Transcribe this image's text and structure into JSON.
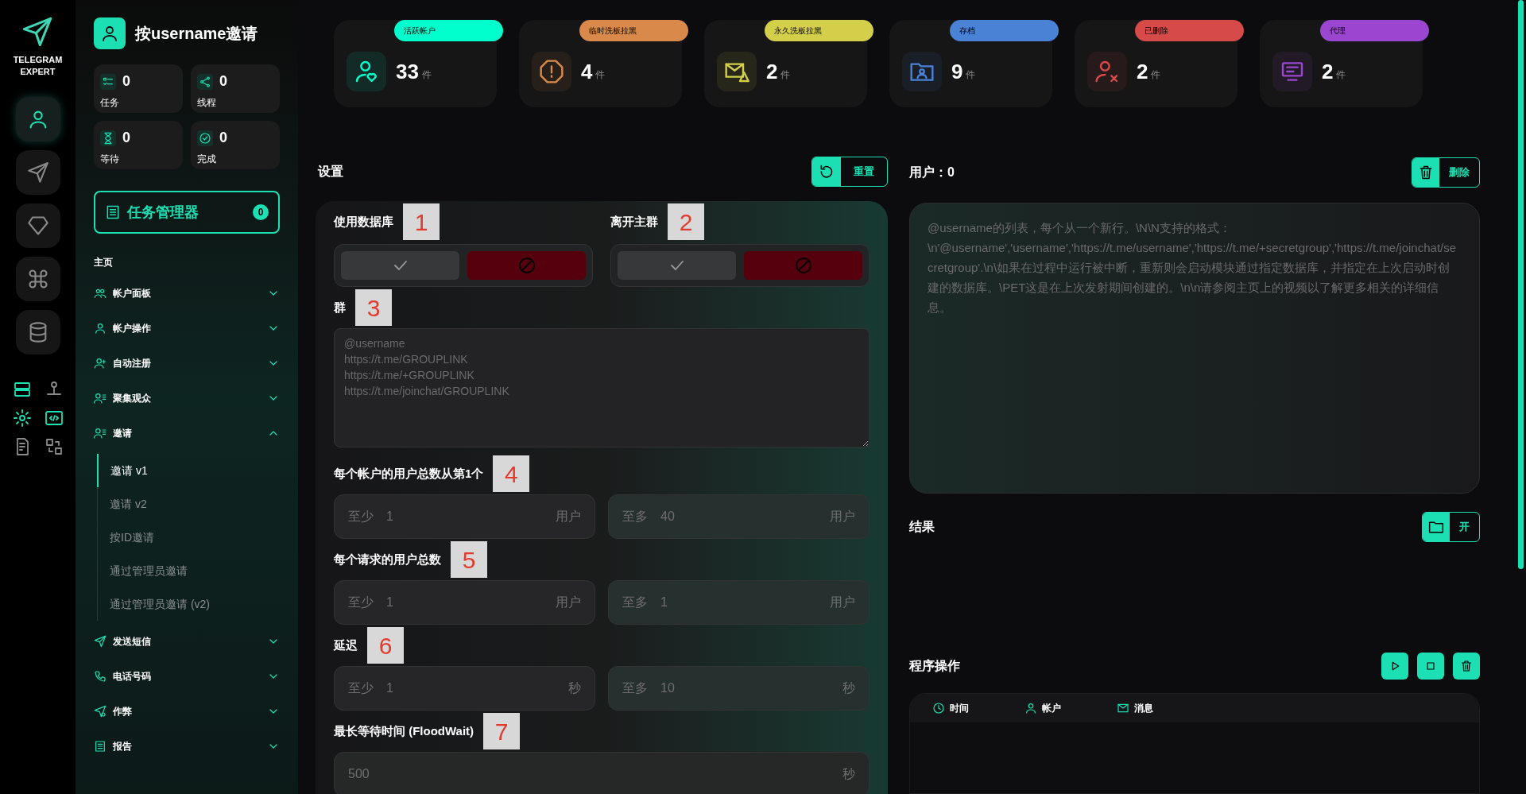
{
  "brand": {
    "line1": "TELEGRAM",
    "line2": "EXPERT"
  },
  "rail": [
    {
      "kind": "user",
      "selected": true
    },
    {
      "kind": "send",
      "selected": false
    },
    {
      "kind": "diamond",
      "selected": false
    },
    {
      "kind": "command",
      "selected": false
    },
    {
      "kind": "database",
      "selected": false
    }
  ],
  "rail_tools": [
    {
      "kind": "server",
      "highlighted": true
    },
    {
      "kind": "network",
      "highlighted": false
    },
    {
      "kind": "gear",
      "highlighted": true
    },
    {
      "kind": "code",
      "highlighted": true
    },
    {
      "kind": "doc",
      "highlighted": false
    },
    {
      "kind": "swap",
      "highlighted": false
    }
  ],
  "sidebar": {
    "title": "按username邀请",
    "stats": [
      {
        "kind": "list",
        "value": "0",
        "label": "任务"
      },
      {
        "kind": "share",
        "value": "0",
        "label": "线程"
      },
      {
        "kind": "hourglass",
        "value": "0",
        "label": "等待"
      },
      {
        "kind": "done",
        "value": "0",
        "label": "完成"
      }
    ],
    "task_manager": {
      "label": "任务管理器",
      "count": "0"
    },
    "section": "主页",
    "items": [
      {
        "kind": "users",
        "label": "帐户面板",
        "expanded": false
      },
      {
        "kind": "user",
        "label": "帐户操作",
        "expanded": false
      },
      {
        "kind": "user-plus",
        "label": "自动注册",
        "expanded": false
      },
      {
        "kind": "user-list",
        "label": "聚集观众",
        "expanded": false
      },
      {
        "kind": "user-list",
        "label": "邀请",
        "expanded": true,
        "children": [
          {
            "label": "邀请 v1",
            "selected": true
          },
          {
            "label": "邀请 v2",
            "selected": false
          },
          {
            "label": "按ID邀请",
            "selected": false
          },
          {
            "label": "通过管理员邀请",
            "selected": false
          },
          {
            "label": "通过管理员邀请 (v2)",
            "selected": false
          }
        ]
      },
      {
        "kind": "send",
        "label": "发送短信",
        "expanded": false
      },
      {
        "kind": "phone",
        "label": "电话号码",
        "expanded": false
      },
      {
        "kind": "send-dot",
        "label": "作弊",
        "expanded": false
      },
      {
        "kind": "report",
        "label": "报告",
        "expanded": false
      }
    ]
  },
  "stat_cards": [
    {
      "kind": "user-heart",
      "badge": "活跃帐户",
      "color": "#00ffcc",
      "value": "33",
      "unit": "件"
    },
    {
      "kind": "warning",
      "badge": "临时洗板拉黑",
      "color": "#d98a4a",
      "value": "4",
      "unit": "件"
    },
    {
      "kind": "mail-warning",
      "badge": "永久洗板拉黑",
      "color": "#d4cf4a",
      "value": "2",
      "unit": "件"
    },
    {
      "kind": "folder-user",
      "badge": "存档",
      "color": "#4a82d6",
      "value": "9",
      "unit": "件"
    },
    {
      "kind": "user-x",
      "badge": "已删除",
      "color": "#d64a4a",
      "value": "2",
      "unit": "件"
    },
    {
      "kind": "proxy",
      "badge": "代理",
      "color": "#9b46d0",
      "value": "2",
      "unit": "件"
    }
  ],
  "settings": {
    "title": "设置",
    "reset_button": "重置",
    "toggles": [
      {
        "label": "使用数据库",
        "marker": "1",
        "value": false
      },
      {
        "label": "离开主群",
        "marker": "2",
        "value": false
      }
    ],
    "groups": {
      "label": "群",
      "marker": "3",
      "placeholder": "@username\nhttps://t.me/GROUPLINK\nhttps://t.me/+GROUPLINK\nhttps://t.me/joinchat/GROUPLINK"
    },
    "ranges": [
      {
        "label": "每个帐户的用户总数从第1个",
        "marker": "4",
        "min_prefix": "至少",
        "min": "1",
        "min_unit": "用户",
        "max_prefix": "至多",
        "max": "40",
        "max_unit": "用户"
      },
      {
        "label": "每个请求的用户总数",
        "marker": "5",
        "min_prefix": "至少",
        "min": "1",
        "min_unit": "用户",
        "max_prefix": "至多",
        "max": "1",
        "max_unit": "用户"
      },
      {
        "label": "延迟",
        "marker": "6",
        "min_prefix": "至少",
        "min": "1",
        "min_unit": "秒",
        "max_prefix": "至多",
        "max": "10",
        "max_unit": "秒"
      }
    ],
    "flood_wait": {
      "label": "最长等待时间 (FloodWait)",
      "marker": "7",
      "placeholder": "500",
      "unit": "秒"
    }
  },
  "users": {
    "title": "用户：0",
    "delete_button": "删除",
    "placeholder": "@username的列表，每个从一个新行。\\N\\N支持的格式：\\n'@username','username','https://t.me/username','https://t.me/+secretgroup','https://t.me/joinchat/secretgroup'.\\n\\如果在过程中运行被中断，重新则会启动模块通过指定数据库，并指定在上次启动时创建的数据库。\\PET这是在上次发射期间创建的。\\n\\n请参阅主页上的视频以了解更多相关的详细信息。"
  },
  "results": {
    "title": "结果",
    "open_button": "开"
  },
  "operations": {
    "title": "程序操作",
    "controls": [
      {
        "kind": "play"
      },
      {
        "kind": "stop"
      },
      {
        "kind": "trash"
      }
    ],
    "columns": [
      {
        "kind": "clock",
        "label": "时间"
      },
      {
        "kind": "user",
        "label": "帐户"
      },
      {
        "kind": "mail",
        "label": "消息"
      }
    ]
  }
}
